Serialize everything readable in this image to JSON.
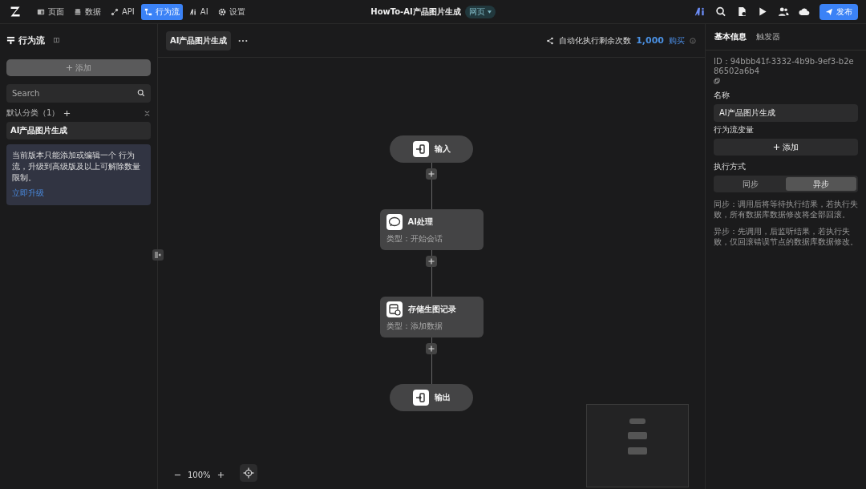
{
  "topbar": {
    "nav": [
      {
        "label": "页面",
        "selected": false
      },
      {
        "label": "数据",
        "selected": false
      },
      {
        "label": "API",
        "selected": false
      },
      {
        "label": "行为流",
        "selected": true
      },
      {
        "label": "AI",
        "selected": false
      },
      {
        "label": "设置",
        "selected": false
      }
    ],
    "title": "HowTo-AI产品图片生成",
    "mode": "网页",
    "publish": "发布"
  },
  "sidebar": {
    "title": "行为流",
    "add": "添加",
    "search": {
      "placeholder": "Search"
    },
    "category": "默认分类（1）",
    "items": [
      {
        "label": "AI产品图片生成",
        "selected": true
      }
    ],
    "notice": "当前版本只能添加或编辑一个 行为流，升级到高级版及以上可解除数量限制。",
    "upgrade": "立即升级"
  },
  "canvas": {
    "tab": "AI产品图片生成",
    "quota_label": "自动化执行剩余次数",
    "quota": "1,000",
    "buy": "购买",
    "nodes": [
      {
        "kind": "terminal",
        "label": "输入"
      },
      {
        "kind": "step",
        "label": "AI处理",
        "type": "类型：开始会话"
      },
      {
        "kind": "step",
        "label": "存储生图记录",
        "type": "类型：添加数据"
      },
      {
        "kind": "terminal",
        "label": "输出"
      }
    ],
    "zoom": "100%"
  },
  "panel": {
    "tabs": [
      {
        "label": "基本信息",
        "selected": true
      },
      {
        "label": "触发器",
        "selected": false
      }
    ],
    "id": "ID：94bbb41f-3332-4b9b-9ef3-b2e86502a6b4",
    "name_label": "名称",
    "name": "AI产品图片生成",
    "vars_label": "行为流变量",
    "vars_add": "添加",
    "exec_label": "执行方式",
    "exec": [
      {
        "label": "同步",
        "selected": false
      },
      {
        "label": "异步",
        "selected": true
      }
    ],
    "notes": [
      "同步：调用后将等待执行结果，若执行失败，所有数据库数据修改将全部回滚。",
      "异步：先调用，后监听结果，若执行失败，仅回滚错误节点的数据库数据修改。"
    ]
  }
}
